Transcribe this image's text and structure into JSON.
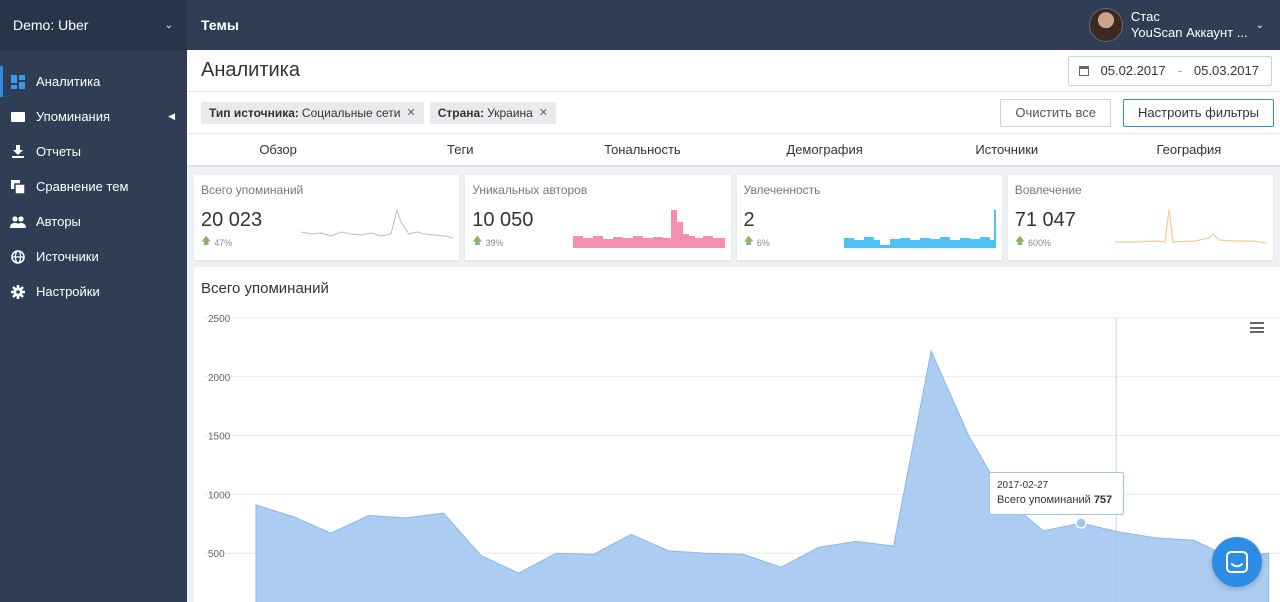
{
  "sidebar": {
    "project": "Demo: Uber",
    "items": [
      {
        "label": "Аналитика",
        "icon": "dashboard-icon"
      },
      {
        "label": "Упоминания",
        "icon": "mentions-icon"
      },
      {
        "label": "Отчеты",
        "icon": "download-icon"
      },
      {
        "label": "Сравнение тем",
        "icon": "compare-icon"
      },
      {
        "label": "Авторы",
        "icon": "users-icon"
      },
      {
        "label": "Источники",
        "icon": "globe-icon"
      },
      {
        "label": "Настройки",
        "icon": "gear-icon"
      }
    ]
  },
  "topbar": {
    "title": "Темы",
    "user_name": "Стас",
    "account": "YouScan Аккаунт ..."
  },
  "header": {
    "title": "Аналитика",
    "date_from": "05.02.2017",
    "date_sep": "-",
    "date_to": "05.03.2017"
  },
  "filters": {
    "chips": [
      {
        "key": "Тип источника:",
        "value": "Социальные сети"
      },
      {
        "key": "Страна:",
        "value": "Украина"
      }
    ],
    "clear_label": "Очистить все",
    "configure_label": "Настроить фильтры"
  },
  "tabs": [
    "Обзор",
    "Теги",
    "Тональность",
    "Демография",
    "Источники",
    "География"
  ],
  "cards": [
    {
      "label": "Всего упоминаний",
      "value": "20 023",
      "change": "47%",
      "color": "#c7cdd3"
    },
    {
      "label": "Уникальных авторов",
      "value": "10 050",
      "change": "39%",
      "color": "#f48fb1"
    },
    {
      "label": "Увлеченность",
      "value": "2",
      "change": "6%",
      "color": "#4fc3f7"
    },
    {
      "label": "Вовлечение",
      "value": "71 047",
      "change": "600%",
      "color": "#f5cf8a"
    }
  ],
  "tooltip": {
    "date": "2017-02-27",
    "label": "Всего упоминаний",
    "value": "757"
  },
  "chart_data": {
    "type": "area",
    "title": "Всего упоминаний",
    "ylim": [
      0,
      2500
    ],
    "yticks": [
      2500,
      2000,
      1500,
      1000,
      500
    ],
    "grid": true,
    "color": "#9ec4ef",
    "series": [
      {
        "x": [
          "2017-02-05",
          "2017-02-06",
          "2017-02-07",
          "2017-02-08",
          "2017-02-09",
          "2017-02-10",
          "2017-02-11",
          "2017-02-12",
          "2017-02-13",
          "2017-02-14",
          "2017-02-15",
          "2017-02-16",
          "2017-02-17",
          "2017-02-18",
          "2017-02-19",
          "2017-02-20",
          "2017-02-21",
          "2017-02-22",
          "2017-02-23",
          "2017-02-24",
          "2017-02-25",
          "2017-02-26",
          "2017-02-27",
          "2017-02-28",
          "2017-03-01",
          "2017-03-02",
          "2017-03-03",
          "2017-03-04"
        ],
        "values": [
          910,
          810,
          670,
          820,
          800,
          840,
          480,
          330,
          500,
          490,
          660,
          520,
          500,
          490,
          380,
          550,
          600,
          560,
          2220,
          1500,
          950,
          690,
          757,
          680,
          630,
          610,
          460,
          500
        ]
      }
    ]
  }
}
